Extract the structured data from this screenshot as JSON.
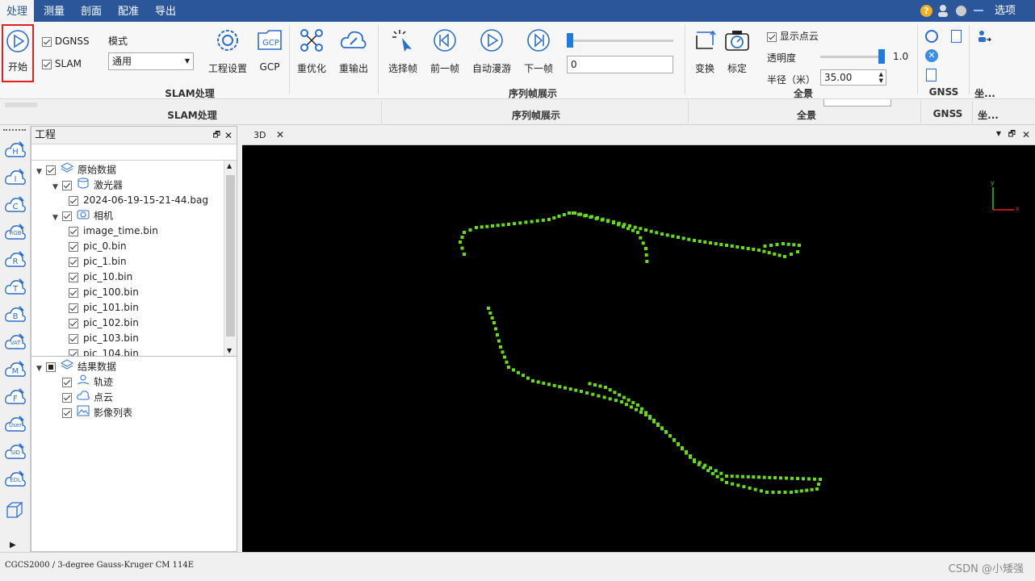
{
  "menu": {
    "items": [
      "处理",
      "测量",
      "剖面",
      "配准",
      "导出"
    ],
    "right_option": "选项"
  },
  "ribbon": {
    "start_label": "开始",
    "dgnss_label": "DGNSS",
    "slam_label": "SLAM",
    "mode_label": "模式",
    "mode_value": "通用",
    "project_settings_label": "工程设置",
    "gcp_label": "GCP",
    "reoptimize_label": "重优化",
    "reexport_label": "重输出",
    "group_slam": "SLAM处理",
    "select_frame_label": "选择帧",
    "prev_frame_label": "前一帧",
    "auto_roam_label": "自动漫游",
    "next_frame_label": "下一帧",
    "frame_value": "0",
    "group_sequence": "序列帧展示",
    "transform_label": "变换",
    "calibrate_label": "标定",
    "show_cloud_label": "显示点云",
    "opacity_label": "透明度",
    "opacity_value": "1.0",
    "radius_label": "半径（米）",
    "radius_value": "35.00",
    "group_panorama": "全景",
    "group_gnss": "GNSS",
    "group_coord": "坐..."
  },
  "project": {
    "title": "工程",
    "tree": [
      {
        "label": "原始数据",
        "level": 0,
        "expanded": true,
        "checked": true,
        "icon": "layers-icon"
      },
      {
        "label": "激光器",
        "level": 1,
        "expanded": true,
        "checked": true,
        "icon": "database-icon"
      },
      {
        "label": "2024-06-19-15-21-44.bag",
        "level": 2,
        "checked": true
      },
      {
        "label": "相机",
        "level": 1,
        "expanded": true,
        "checked": true,
        "icon": "camera-icon"
      },
      {
        "label": "image_time.bin",
        "level": 2,
        "checked": true
      },
      {
        "label": "pic_0.bin",
        "level": 2,
        "checked": true
      },
      {
        "label": "pic_1.bin",
        "level": 2,
        "checked": true
      },
      {
        "label": "pic_10.bin",
        "level": 2,
        "checked": true
      },
      {
        "label": "pic_100.bin",
        "level": 2,
        "checked": true
      },
      {
        "label": "pic_101.bin",
        "level": 2,
        "checked": true
      },
      {
        "label": "pic_102.bin",
        "level": 2,
        "checked": true
      },
      {
        "label": "pic_103.bin",
        "level": 2,
        "checked": true
      },
      {
        "label": "pic_104.bin",
        "level": 2,
        "checked": true
      }
    ],
    "results": [
      {
        "label": "结果数据",
        "level": 0,
        "expanded": true,
        "checked": "partial",
        "icon": "layers-icon"
      },
      {
        "label": "轨迹",
        "level": 1,
        "checked": true,
        "icon": "trajectory-icon"
      },
      {
        "label": "点云",
        "level": 1,
        "checked": true,
        "icon": "cloud-icon"
      },
      {
        "label": "影像列表",
        "level": 1,
        "checked": true,
        "icon": "image-list-icon"
      }
    ]
  },
  "leftbar": {
    "icons": [
      "H",
      "I",
      "C",
      "RGB",
      "R",
      "T",
      "B",
      "VAT",
      "M",
      "F",
      "User",
      "SID",
      "EDL"
    ]
  },
  "viewport": {
    "tab_label": "3D",
    "axis_y": "y",
    "axis_x": "x"
  },
  "status": {
    "crs": "CGCS2000 / 3-degree Gauss-Kruger CM 114E",
    "watermark": "CSDN @小矮强"
  },
  "colors": {
    "accent": "#2b579a",
    "trajectory": "#66dd11",
    "highlight_border": "#e02020"
  }
}
